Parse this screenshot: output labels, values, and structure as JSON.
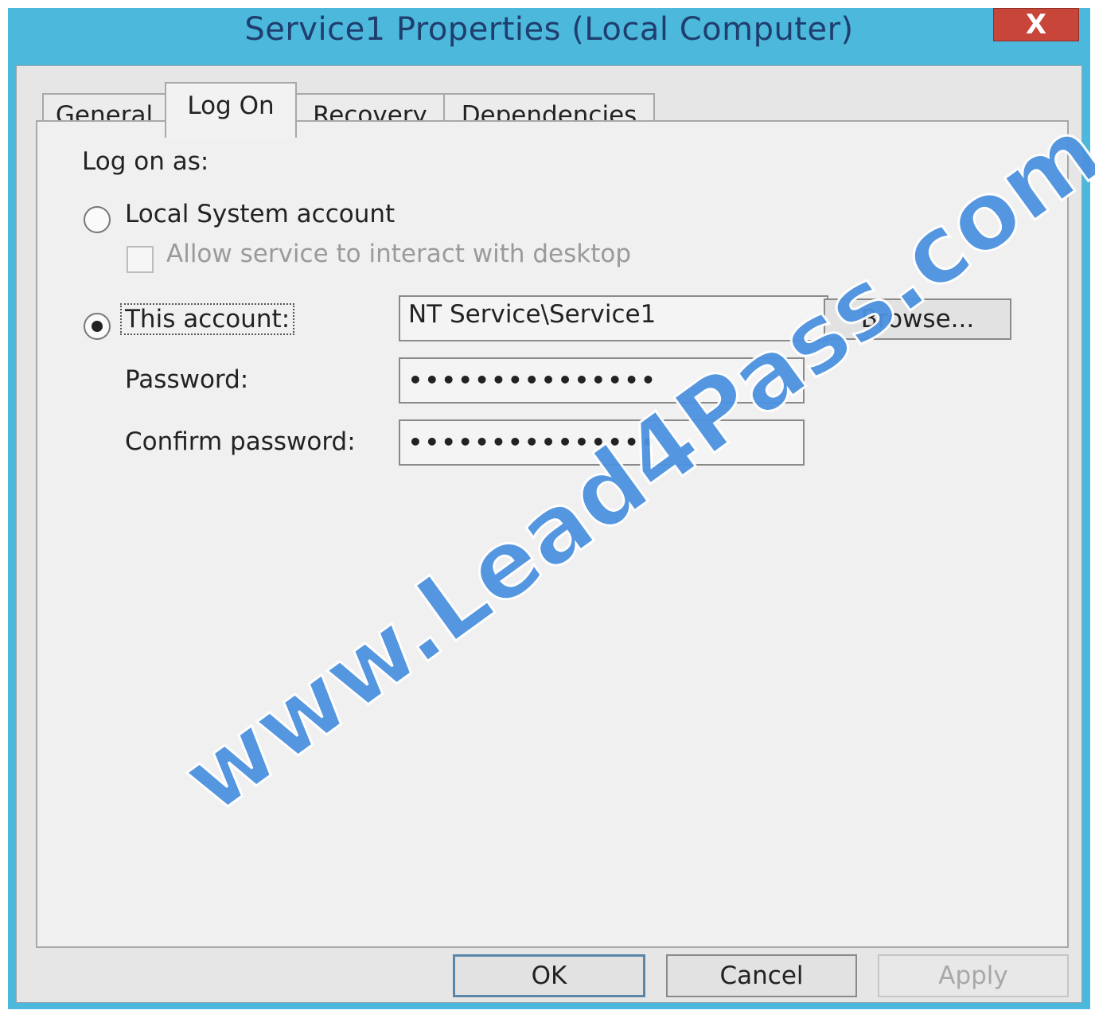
{
  "window": {
    "title": "Service1 Properties (Local Computer)",
    "close_label": "X"
  },
  "tabs": [
    {
      "label": "General",
      "active": false
    },
    {
      "label": "Log On",
      "active": true
    },
    {
      "label": "Recovery",
      "active": false
    },
    {
      "label": "Dependencies",
      "active": false
    }
  ],
  "logon": {
    "heading": "Log on as:",
    "local_system_label": "Local System account",
    "local_system_selected": false,
    "allow_interact_label": "Allow service to interact with desktop",
    "allow_interact_checked": false,
    "this_account_label": "This account:",
    "this_account_selected": true,
    "account_value": "NT Service\\Service1",
    "browse_label": "Browse...",
    "password_label": "Password:",
    "password_value": "•••••••••••••••",
    "confirm_label": "Confirm password:",
    "confirm_value": "•••••••••••••••"
  },
  "buttons": {
    "ok": "OK",
    "cancel": "Cancel",
    "apply": "Apply"
  },
  "watermark": "www.Lead4Pass.com"
}
